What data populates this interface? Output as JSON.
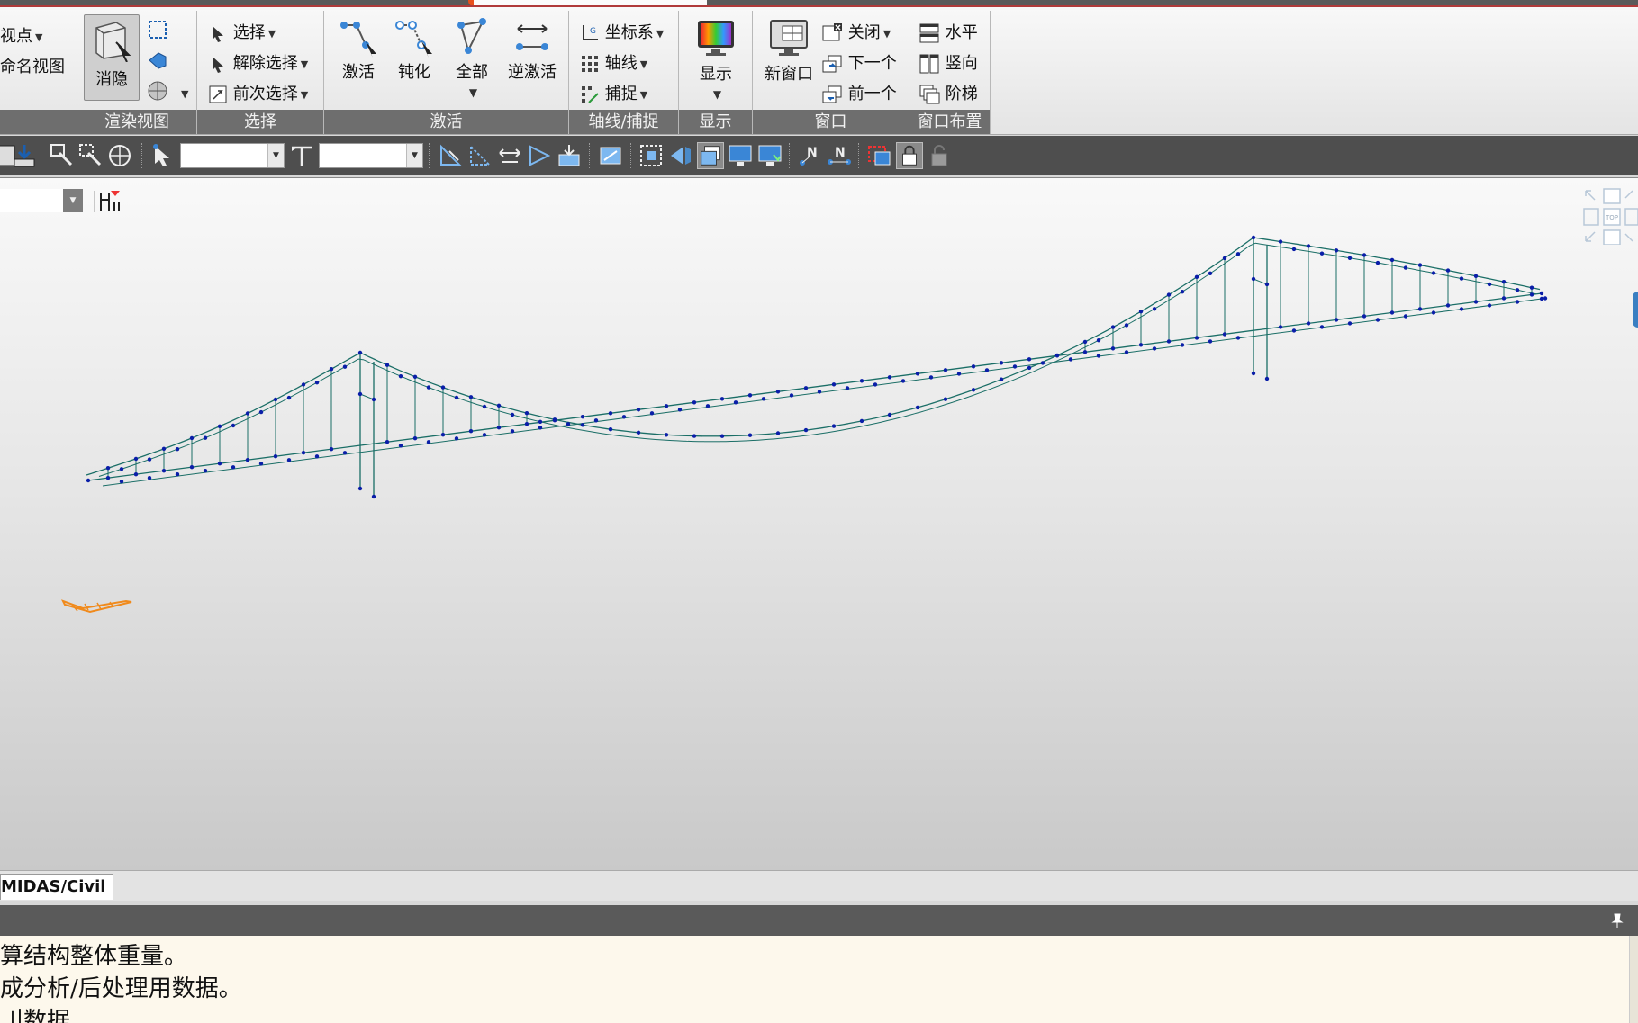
{
  "ribbon": {
    "view_group": {
      "viewpoint_label": "视点",
      "named_view_label": "命名视图"
    },
    "render_group": {
      "title": "渲染视图",
      "hide_label": "消隐"
    },
    "select_group": {
      "title": "选择",
      "select_label": "选择",
      "deselect_label": "解除选择",
      "previous_label": "前次选择"
    },
    "activate_group": {
      "title": "激活",
      "activate_label": "激活",
      "deactivate_label": "钝化",
      "all_label": "全部",
      "inverse_label": "逆激活"
    },
    "axis_group": {
      "title": "轴线/捕捉",
      "ucs_label": "坐标系",
      "grid_label": "轴线",
      "snap_label": "捕捉"
    },
    "display_group": {
      "title": "显示",
      "display_label": "显示"
    },
    "window_group": {
      "title": "窗口",
      "new_window_label": "新窗口",
      "close_label": "关闭",
      "next_label": "下一个",
      "prev_label": "前一个"
    },
    "layout_group": {
      "title": "窗口布置",
      "horizontal_label": "水平",
      "vertical_label": "竖向",
      "cascade_label": "阶梯"
    }
  },
  "toolbar": {
    "select_a_value": "",
    "select_b_value": ""
  },
  "viewport": {
    "view_combo_value": "",
    "viewcube_face": "TOP",
    "colors": {
      "member": "#1a6e66",
      "node": "#0a1ea8",
      "support": "#f08a1c"
    }
  },
  "tabs": {
    "active": "MIDAS/Civil"
  },
  "messages": {
    "lines": [
      "算结构整体重量。",
      "成分析/后处理用数据。",
      "刂数据"
    ]
  }
}
